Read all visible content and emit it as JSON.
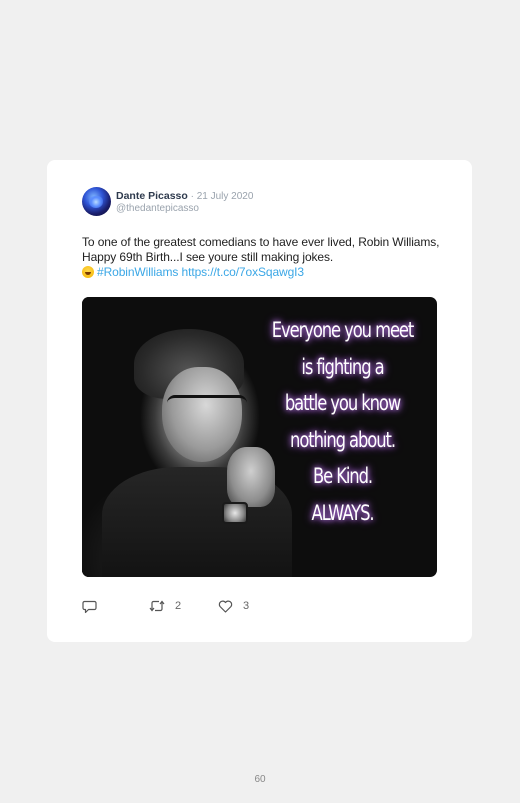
{
  "tweet": {
    "author_name": "Dante Picasso",
    "separator": " · ",
    "date": "21 July 2020",
    "handle": "@thedantepicasso",
    "text_line1": "To one of the greatest comedians to have ever lived, Robin Williams, Happy 69th Birth...I see youre still making jokes.",
    "emoji": "laughing-face-emoji",
    "hashtag": "#RobinWilliams",
    "url": "https://t.co/7oxSqawgI3",
    "media": {
      "quote_lines": [
        "Everyone you meet",
        "is fighting a",
        "battle you know",
        "nothing about.",
        "Be Kind.",
        "ALWAYS."
      ]
    },
    "actions": {
      "reply_icon": "reply-icon",
      "retweet_icon": "retweet-icon",
      "retweet_count": "2",
      "like_icon": "heart-icon",
      "like_count": "3"
    }
  },
  "page": {
    "number": "60"
  },
  "colors": {
    "background": "#f0f0f0",
    "card": "#ffffff",
    "link": "#3ba7e6",
    "muted": "#9aa3ad"
  }
}
